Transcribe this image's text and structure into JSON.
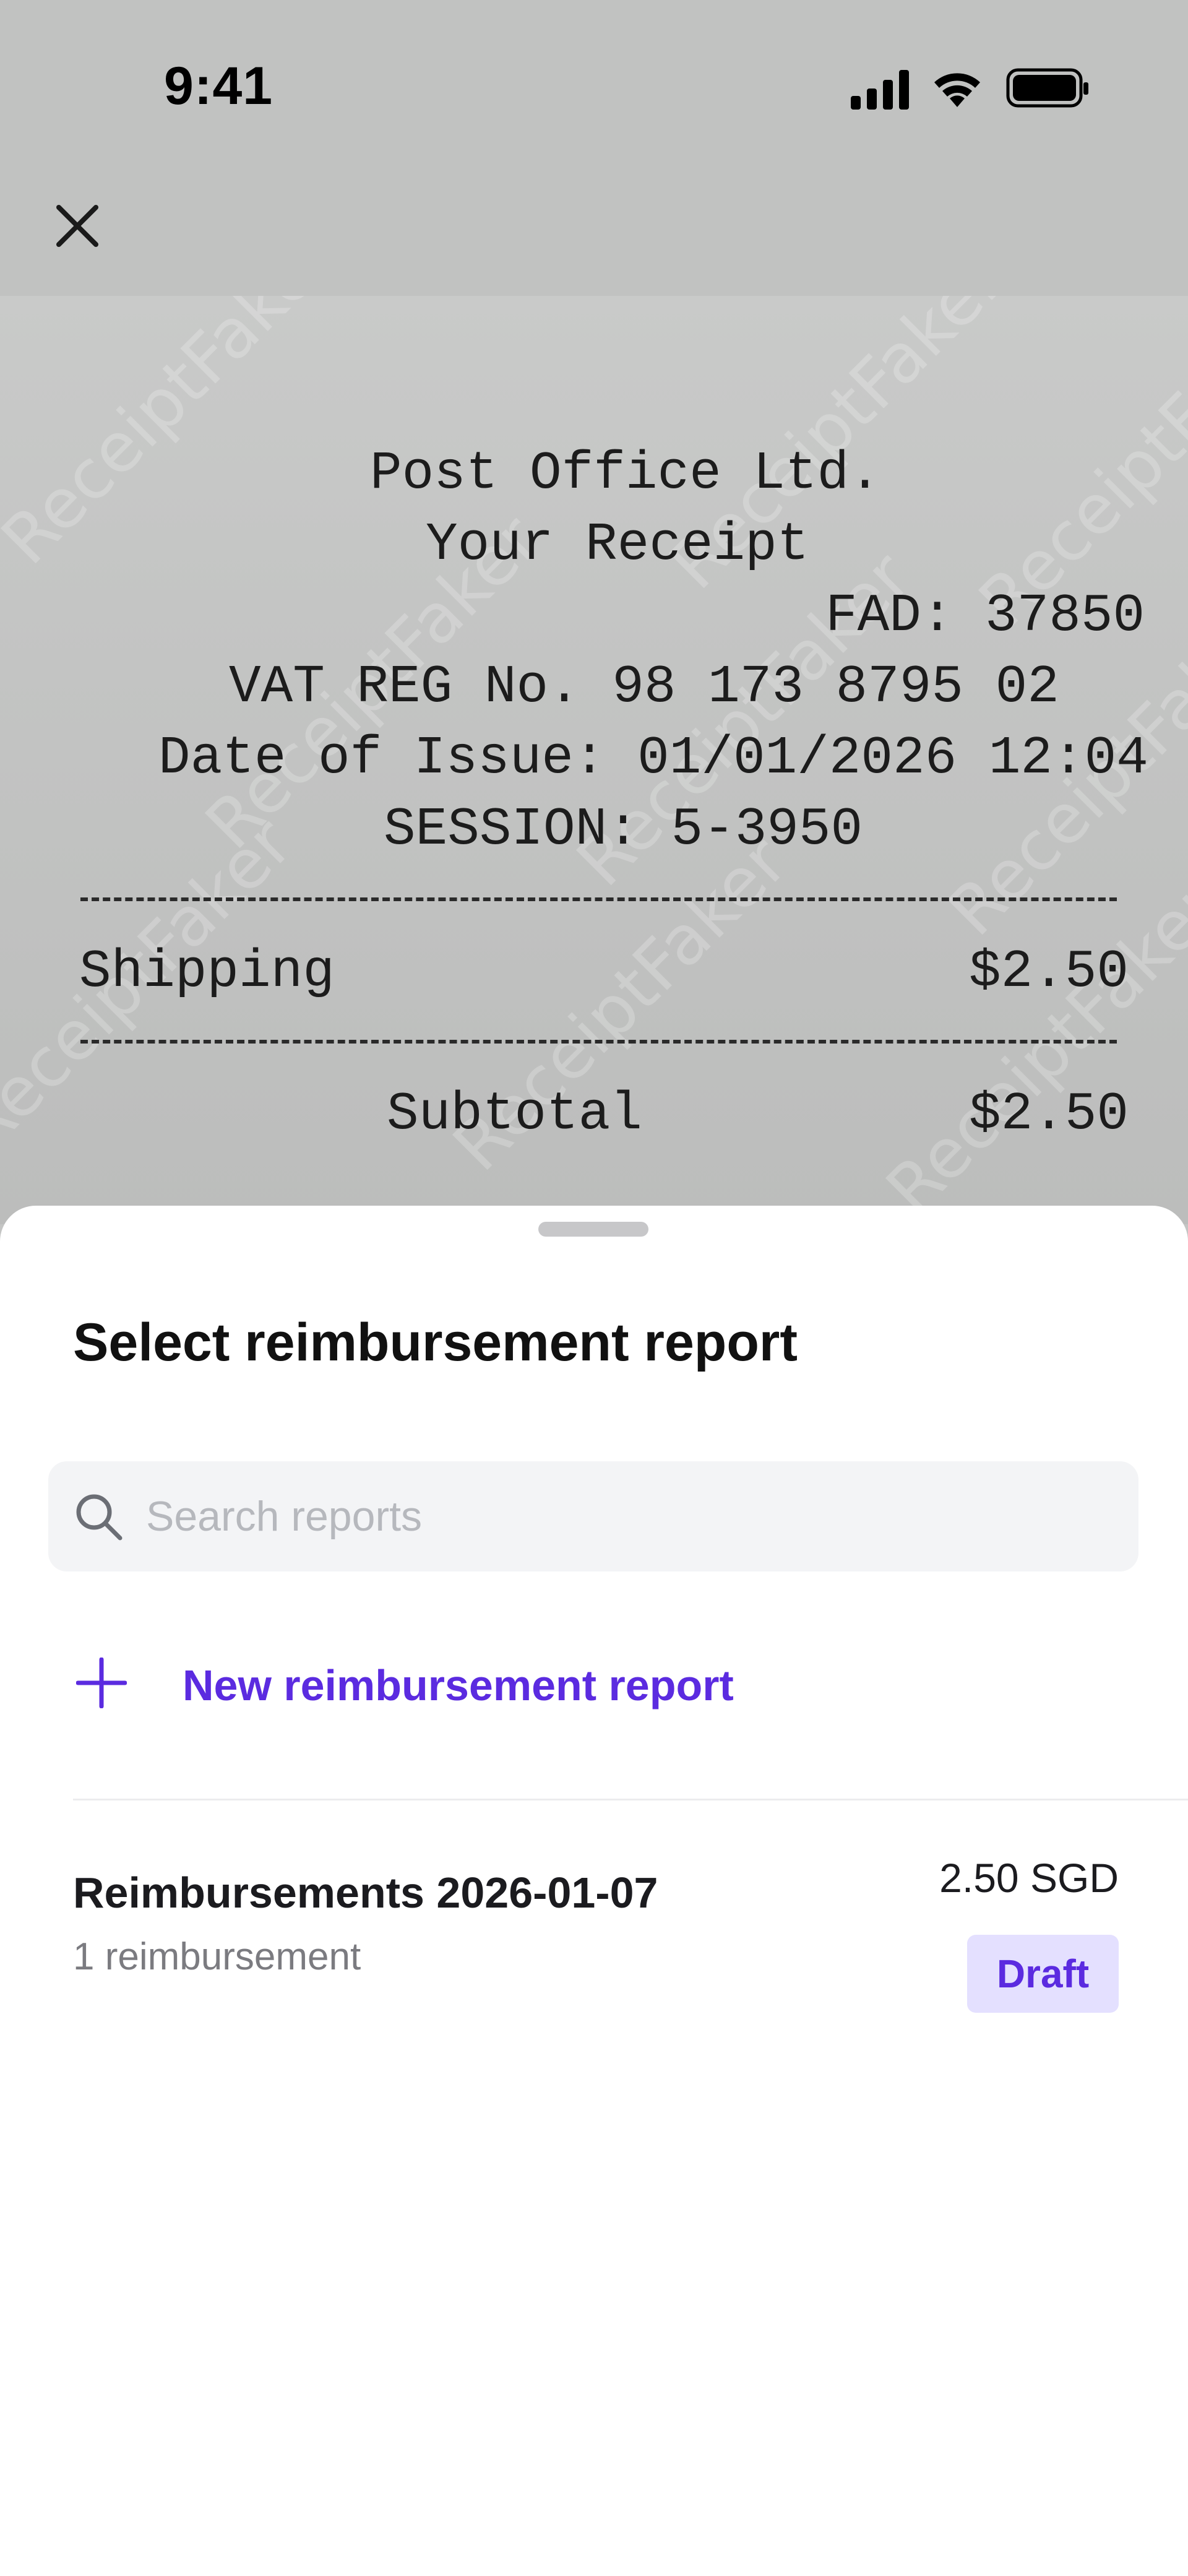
{
  "status_bar": {
    "time": "9:41",
    "icons": [
      "signal-icon",
      "wifi-icon",
      "battery-icon"
    ]
  },
  "header": {
    "close_icon": "close-icon"
  },
  "receipt": {
    "watermark": "ReceiptFaker",
    "lines": {
      "company": "Post Office Ltd.",
      "heading": "Your Receipt",
      "fad": "FAD: 37850",
      "vat": "VAT REG No. 98 173 8795 02",
      "date": "Date of Issue: 01/01/2026 12:04",
      "session": "SESSION: 5-3950",
      "item_name": "Shipping",
      "item_price": "$2.50",
      "subtotal_label": "Subtotal",
      "subtotal_value": "$2.50"
    }
  },
  "sheet": {
    "title": "Select reimbursement report",
    "search": {
      "placeholder": "Search reports",
      "value": ""
    },
    "new_report_label": "New reimbursement report",
    "reports": [
      {
        "name": "Reimbursements 2026-01-07",
        "count": "1 reimbursement",
        "amount": "2.50 SGD",
        "status": "Draft"
      }
    ]
  },
  "colors": {
    "accent": "#5b2be0",
    "badge_bg": "#e4e0ff",
    "search_bg": "#f3f4f6",
    "overlay_gray": "#c4c5c4"
  }
}
